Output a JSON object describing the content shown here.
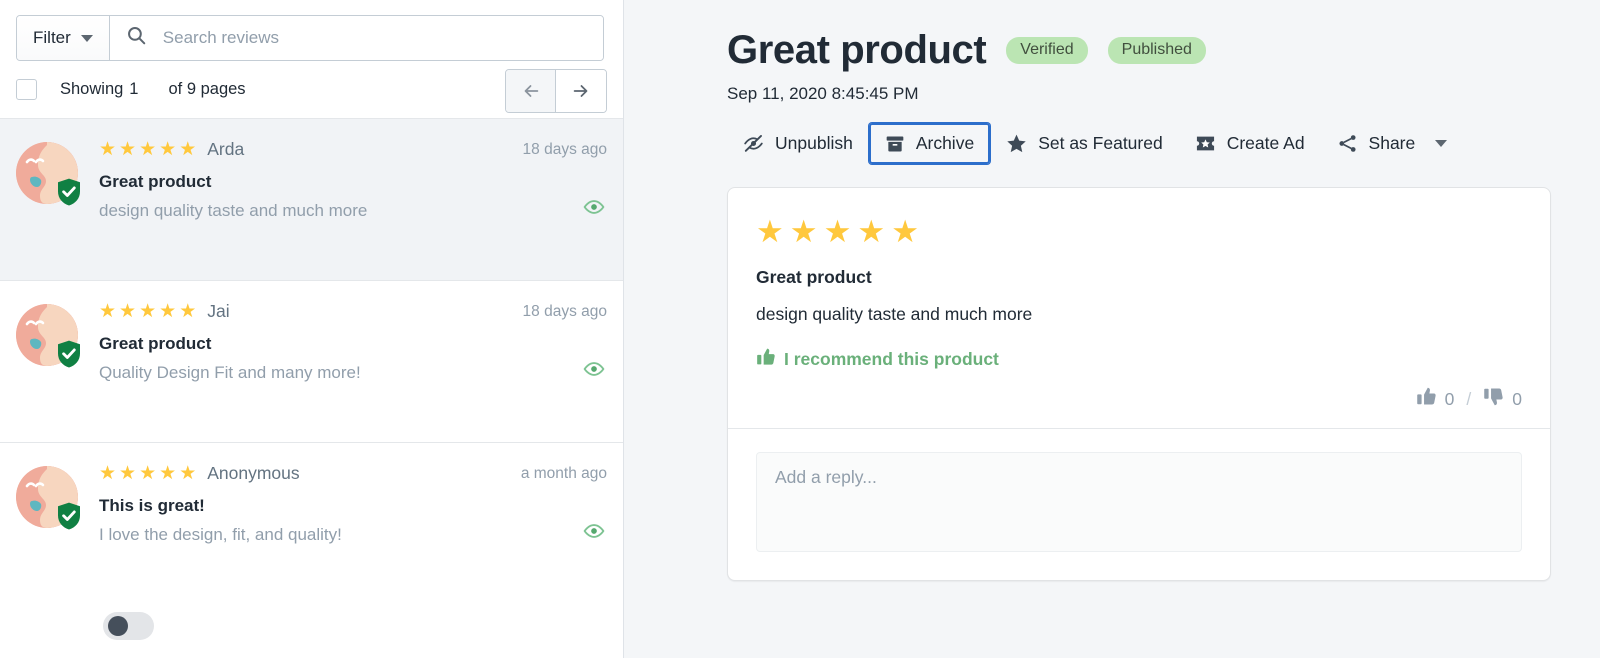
{
  "left": {
    "filter": {
      "label": "Filter",
      "caret_icon": "chevron-down-icon"
    },
    "search": {
      "placeholder": "Search reviews",
      "value": "",
      "icon": "search-icon"
    },
    "toolbar": {
      "showing_label": "Showing",
      "showing_count": "1",
      "of_pages": "of 9 pages",
      "prev_icon": "arrow-left-icon",
      "next_icon": "arrow-right-icon"
    },
    "reviews": [
      {
        "reviewer": "Arda",
        "rating": 5,
        "title": "Great product",
        "text": "design quality taste and much more",
        "time": "18 days ago",
        "selected": true,
        "verified": true,
        "visibility_icon": "eye-icon"
      },
      {
        "reviewer": "Jai",
        "rating": 5,
        "title": "Great product",
        "text": "Quality Design Fit and many more!",
        "time": "18 days ago",
        "selected": false,
        "verified": true,
        "visibility_icon": "eye-icon"
      },
      {
        "reviewer": "Anonymous",
        "rating": 5,
        "title": "This is great!",
        "text": "I love the design, fit, and quality!",
        "time": "a month ago",
        "selected": false,
        "verified": true,
        "visibility_icon": "eye-icon"
      }
    ],
    "toggle": {
      "name": "publish-toggle",
      "state": "off"
    }
  },
  "detail": {
    "title": "Great product",
    "badges": [
      "Verified",
      "Published"
    ],
    "date": "Sep 11, 2020 8:45:45 PM",
    "actions": [
      {
        "label": "Unpublish",
        "icon": "eye-slash-icon",
        "focused": false
      },
      {
        "label": "Archive",
        "icon": "archive-box-icon",
        "focused": true
      },
      {
        "label": "Set as Featured",
        "icon": "star-icon",
        "focused": false
      },
      {
        "label": "Create Ad",
        "icon": "ad-ticket-icon",
        "focused": false
      },
      {
        "label": "Share",
        "icon": "share-nodes-icon",
        "focused": false,
        "has_caret": true
      }
    ],
    "card": {
      "rating": 5,
      "title": "Great product",
      "text": "design quality taste and much more",
      "recommend_label": "I recommend this product",
      "recommend_icon": "thumbs-up-icon",
      "upvotes": "0",
      "downvotes": "0",
      "separator": "/",
      "upvote_icon": "thumbs-up-icon",
      "downvote_icon": "thumbs-down-icon",
      "reply_placeholder": "Add a reply..."
    }
  },
  "colors": {
    "accent_blue": "#2c6ecb",
    "star_yellow": "#ffc83d",
    "badge_green": "#bbe5b3",
    "recommend_green": "#6ab07a",
    "panel_bg": "#f4f6f8"
  }
}
